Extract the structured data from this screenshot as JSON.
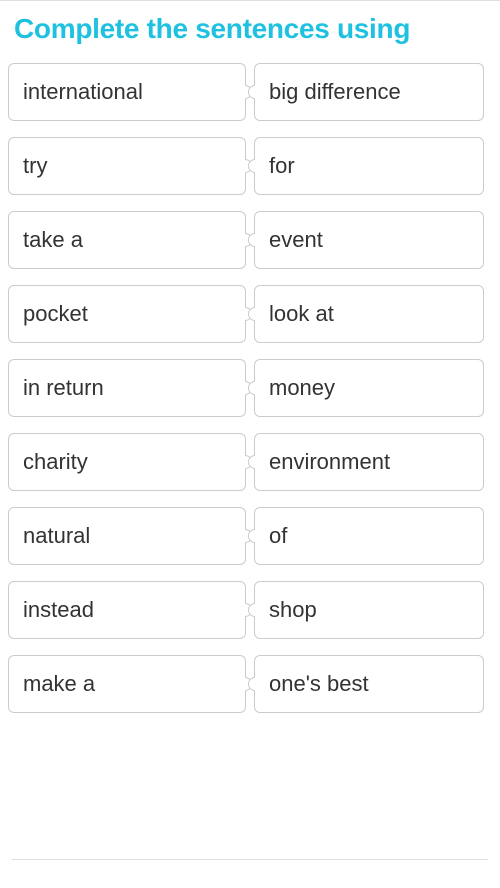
{
  "title": "Complete the sentences using",
  "leftColumn": [
    "international",
    "try",
    "take a",
    "pocket",
    "in return",
    "charity",
    "natural",
    "instead",
    "make a"
  ],
  "rightColumn": [
    "big difference",
    "for",
    "event",
    "look at",
    "money",
    "environment",
    "of",
    "shop",
    "one's best"
  ]
}
